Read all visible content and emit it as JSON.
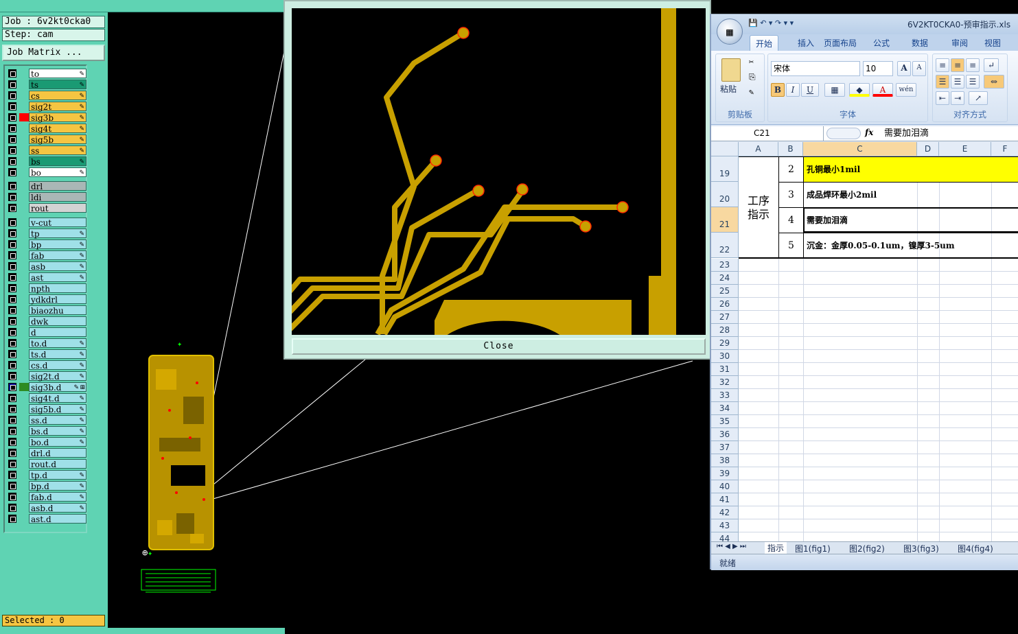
{
  "job": {
    "job_label": "Job : 6v2kt0cka0",
    "step_label": "Step: cam",
    "matrix_button": "Job Matrix ...",
    "selected": "Selected : 0"
  },
  "layers": [
    {
      "name": "to",
      "color": "#ffffff",
      "icon": "pencil-icon"
    },
    {
      "name": "ts",
      "color": "#1a9a73",
      "icon": "pencil-icon"
    },
    {
      "name": "cs",
      "color": "#f5c542",
      "icon": "pencil-icon"
    },
    {
      "name": "sig2t",
      "color": "#f5c542",
      "icon": "pencil-icon"
    },
    {
      "name": "sig3b",
      "color": "#f5c542",
      "icon": "pencil-icon",
      "swatch": "#ff0000"
    },
    {
      "name": "sig4t",
      "color": "#f5c542",
      "icon": "pencil-icon"
    },
    {
      "name": "sig5b",
      "color": "#f5c542",
      "icon": "pencil-icon"
    },
    {
      "name": "ss",
      "color": "#f5c542",
      "icon": "pencil-icon"
    },
    {
      "name": "bs",
      "color": "#1a9a73",
      "icon": "pencil-icon"
    },
    {
      "name": "bo",
      "color": "#ffffff",
      "icon": "pencil-icon"
    },
    {
      "name": "drl",
      "color": "#a9b7b6",
      "icon": ""
    },
    {
      "name": "ldi",
      "color": "#a9b7b6",
      "icon": ""
    },
    {
      "name": "rout",
      "color": "#d3d3d3",
      "icon": ""
    },
    {
      "name": "v-cut",
      "color": "#9fe0e8",
      "icon": ""
    },
    {
      "name": "tp",
      "color": "#9fe0e8",
      "icon": "pencil-icon"
    },
    {
      "name": "bp",
      "color": "#9fe0e8",
      "icon": "pencil-icon"
    },
    {
      "name": "fab",
      "color": "#9fe0e8",
      "icon": "pencil-icon"
    },
    {
      "name": "asb",
      "color": "#9fe0e8",
      "icon": "pencil-icon"
    },
    {
      "name": "ast",
      "color": "#9fe0e8",
      "icon": "pencil-icon"
    },
    {
      "name": "npth",
      "color": "#9fe0e8",
      "icon": ""
    },
    {
      "name": "ydkdrl",
      "color": "#9fe0e8",
      "icon": ""
    },
    {
      "name": "biaozhu",
      "color": "#9fe0e8",
      "icon": ""
    },
    {
      "name": "dwk",
      "color": "#9fe0e8",
      "icon": ""
    },
    {
      "name": "d",
      "color": "#9fe0e8",
      "icon": ""
    },
    {
      "name": "to.d",
      "color": "#9fe0e8",
      "icon": "pencil-icon"
    },
    {
      "name": "ts.d",
      "color": "#9fe0e8",
      "icon": "pencil-icon"
    },
    {
      "name": "cs.d",
      "color": "#9fe0e8",
      "icon": "pencil-icon"
    },
    {
      "name": "sig2t.d",
      "color": "#9fe0e8",
      "icon": "pencil-icon"
    },
    {
      "name": "sig3b.d",
      "color": "#9fe0e8",
      "icon": "pencil-icon",
      "swatch": "#2e8b22",
      "checkbox": "blue",
      "extra_icon": "grid-icon"
    },
    {
      "name": "sig4t.d",
      "color": "#9fe0e8",
      "icon": "pencil-icon"
    },
    {
      "name": "sig5b.d",
      "color": "#9fe0e8",
      "icon": "pencil-icon"
    },
    {
      "name": "ss.d",
      "color": "#9fe0e8",
      "icon": "pencil-icon"
    },
    {
      "name": "bs.d",
      "color": "#9fe0e8",
      "icon": "pencil-icon"
    },
    {
      "name": "bo.d",
      "color": "#9fe0e8",
      "icon": "pencil-icon"
    },
    {
      "name": "drl.d",
      "color": "#9fe0e8",
      "icon": ""
    },
    {
      "name": "rout.d",
      "color": "#9fe0e8",
      "icon": ""
    },
    {
      "name": "tp.d",
      "color": "#9fe0e8",
      "icon": "pencil-icon"
    },
    {
      "name": "bp.d",
      "color": "#9fe0e8",
      "icon": "pencil-icon"
    },
    {
      "name": "fab.d",
      "color": "#9fe0e8",
      "icon": "pencil-icon"
    },
    {
      "name": "asb.d",
      "color": "#9fe0e8",
      "icon": "pencil-icon"
    },
    {
      "name": "ast.d",
      "color": "#9fe0e8",
      "icon": ""
    }
  ],
  "zoom_window": {
    "close_label": "Close"
  },
  "excel": {
    "title": "6V2KT0CKA0-预审指示.xls",
    "tabs": [
      "开始",
      "插入",
      "页面布局",
      "公式",
      "数据",
      "审阅",
      "视图"
    ],
    "active_tab": "开始",
    "ribbon": {
      "paste_label": "粘贴",
      "clipboard_group": "剪贴板",
      "font_group": "字体",
      "align_group": "对齐方式",
      "font_name": "宋体",
      "font_size": "10",
      "grow_font": "A",
      "shrink_font": "A",
      "bold": "B",
      "italic": "I",
      "underline": "U",
      "font_color": "A",
      "phonetic": "wén"
    },
    "name_box": "C21",
    "fx_label": "fx",
    "formula": "需要加泪滴",
    "columns": [
      "A",
      "B",
      "C",
      "D",
      "E",
      "F"
    ],
    "merged_label": "工序\n指示",
    "data_rows": [
      {
        "row": "19",
        "num": "2",
        "text": "孔铜最小1mil",
        "highlight": "#ffff00"
      },
      {
        "row": "20",
        "num": "3",
        "text": "成品焊环最小2mil"
      },
      {
        "row": "21",
        "num": "4",
        "text": "需要加泪滴"
      },
      {
        "row": "22",
        "num": "5",
        "text": "沉金：金厚0.05-0.1um，镍厚3-5um"
      }
    ],
    "empty_rows": [
      "23",
      "24",
      "25",
      "26",
      "27",
      "28",
      "29",
      "30",
      "31",
      "32",
      "33",
      "34",
      "35",
      "36",
      "37",
      "38",
      "39",
      "40",
      "41",
      "42",
      "43",
      "44"
    ],
    "sheet_tabs": [
      "指示",
      "图1(fig1)",
      "图2(fig2)",
      "图3(fig3)",
      "图4(fig4)"
    ],
    "status": "就绪"
  },
  "colors": {
    "panel": "#5fd3b3",
    "copper": "#c8a000",
    "pad_outline": "#ff2a00"
  }
}
